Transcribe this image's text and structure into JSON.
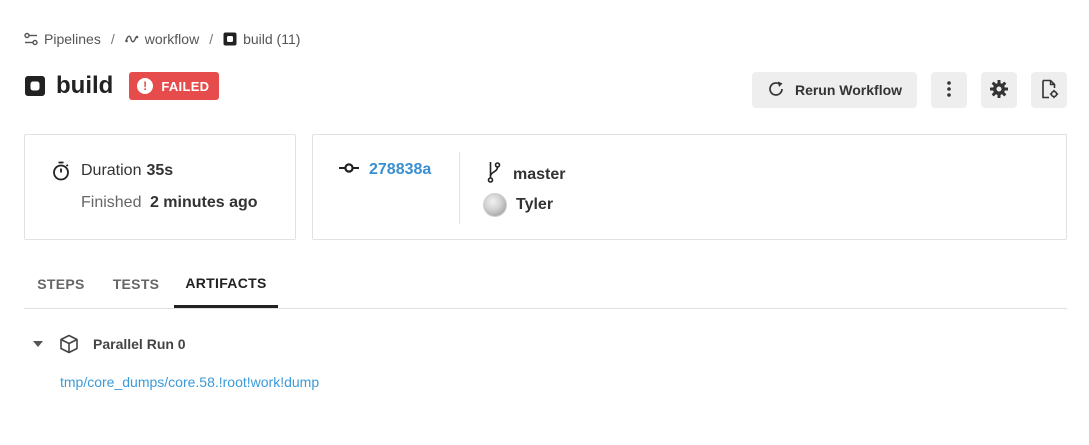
{
  "breadcrumb": {
    "items": [
      {
        "label": "Pipelines",
        "icon": "pipelines-icon"
      },
      {
        "label": "workflow",
        "icon": "workflow-icon"
      },
      {
        "label": "build (11)",
        "icon": "job-icon"
      }
    ],
    "separator": "/"
  },
  "header": {
    "title": "build",
    "status": "FAILED",
    "status_color": "#e74c4c",
    "rerun_label": "Rerun Workflow"
  },
  "summary": {
    "duration_label": "Duration",
    "duration_value": "35s",
    "finished_label": "Finished",
    "finished_value": "2 minutes ago",
    "commit": "278838a",
    "branch": "master",
    "author": "Tyler"
  },
  "tabs": [
    {
      "label": "STEPS",
      "active": false
    },
    {
      "label": "TESTS",
      "active": false
    },
    {
      "label": "ARTIFACTS",
      "active": true
    }
  ],
  "artifacts": {
    "group_label": "Parallel Run 0",
    "items": [
      "tmp/core_dumps/core.58.!root!work!dump"
    ]
  },
  "colors": {
    "link": "#3a9ad9",
    "commit": "#3a8fd0",
    "button_bg": "#eeeeee"
  }
}
